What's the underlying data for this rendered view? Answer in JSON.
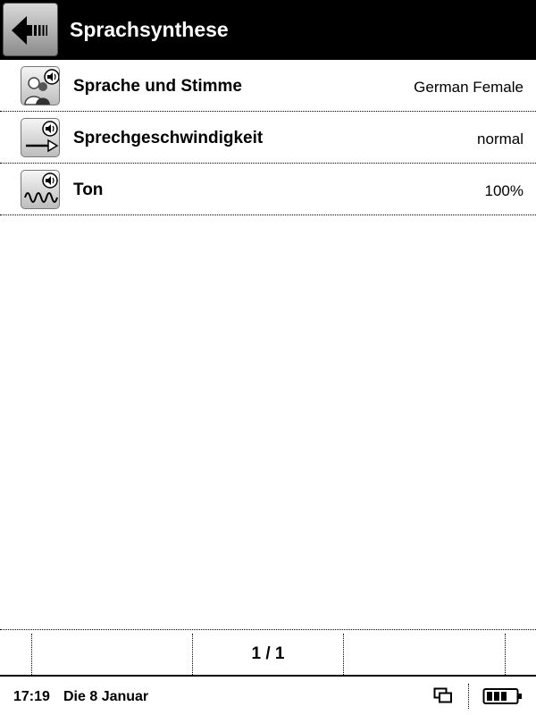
{
  "header": {
    "title": "Sprachsynthese",
    "back_icon": "arrow-left-icon"
  },
  "settings": [
    {
      "label": "Sprache und Stimme",
      "value": "German Female",
      "icon": "voice-people-icon"
    },
    {
      "label": "Sprechgeschwindigkeit",
      "value": "normal",
      "icon": "speech-speed-icon"
    },
    {
      "label": "Ton",
      "value": "100%",
      "icon": "tone-wave-icon"
    }
  ],
  "pagination": {
    "indicator": "1 / 1"
  },
  "status_bar": {
    "time": "17:19",
    "date": "Die 8 Januar",
    "battery_level": 0.75
  }
}
